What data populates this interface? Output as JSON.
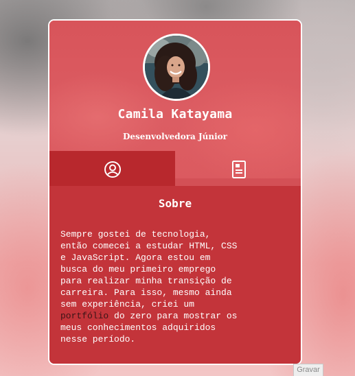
{
  "profile": {
    "name": "Camila Katayama",
    "role": "Desenvolvedora Júnior"
  },
  "tabs": [
    {
      "icon": "user-circle-icon",
      "active": true
    },
    {
      "icon": "document-icon",
      "active": false
    }
  ],
  "about": {
    "title": "Sobre",
    "text_before_link": "Sempre gostei de tecnologia,\nentão comecei a estudar HTML, CSS\ne JavaScript. Agora estou em\nbusca do meu primeiro emprego\npara realizar minha transição de\ncarreira. Para isso, mesmo ainda\nsem experiência, criei um\n",
    "link_text": "portfólio",
    "text_after_link": " do zero para mostrar os\nmeus conhecimentos adquiridos\nnesse período."
  },
  "overlay": {
    "gravar_label": "Gravar"
  },
  "colors": {
    "card_top": "#db5a5f",
    "card_body": "#c3343a",
    "active_tab": "#b8282d",
    "link": "#3a1416",
    "border": "#ffffff"
  }
}
